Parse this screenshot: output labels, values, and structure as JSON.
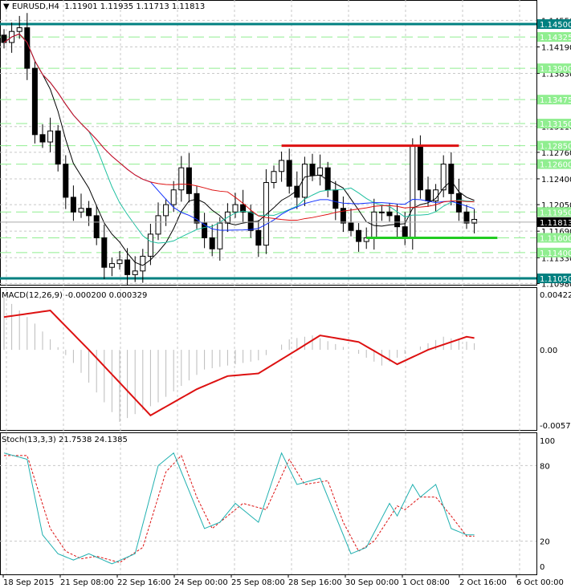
{
  "header": {
    "symbol": "EURUSD,H4",
    "open": "1.11901",
    "high": "1.11935",
    "low": "1.11713",
    "close": "1.11813"
  },
  "price_axis": {
    "min": 1.1098,
    "max": 1.1455,
    "ticks": [
      "1.14550",
      "1.14190",
      "1.13830",
      "1.13110",
      "1.12760",
      "1.12400",
      "1.12050",
      "1.11690",
      "1.11330",
      "1.10980"
    ],
    "current": "1.11813"
  },
  "levels": [
    {
      "price": 1.145,
      "label": "1.14500",
      "color": "#008080",
      "major": true
    },
    {
      "price": 1.14325,
      "label": "1.14325",
      "color": "#90ee90"
    },
    {
      "price": 1.139,
      "label": "1.13900",
      "color": "#90ee90"
    },
    {
      "price": 1.13475,
      "label": "1.13475",
      "color": "#90ee90"
    },
    {
      "price": 1.1315,
      "label": "1.13150",
      "color": "#90ee90"
    },
    {
      "price": 1.1285,
      "label": "1.12850",
      "color": "#90ee90"
    },
    {
      "price": 1.126,
      "label": "1.12600",
      "color": "#90ee90"
    },
    {
      "price": 1.1195,
      "label": "1.11950",
      "color": "#90ee90"
    },
    {
      "price": 1.116,
      "label": "1.11600",
      "color": "#90ee90"
    },
    {
      "price": 1.114,
      "label": "1.11400",
      "color": "#90ee90"
    },
    {
      "price": 1.1105,
      "label": "1.11050",
      "color": "#008080",
      "major": true
    }
  ],
  "resistance": {
    "price": 1.1285,
    "from": 36,
    "to": 59,
    "color": "#dd1111"
  },
  "support": {
    "price": 1.116,
    "from": 47,
    "to": 64,
    "color": "#22cc22"
  },
  "closes": [
    1.1425,
    1.144,
    1.1445,
    1.139,
    1.13,
    1.129,
    1.1305,
    1.126,
    1.1215,
    1.1195,
    1.12,
    1.119,
    1.116,
    1.112,
    1.1125,
    1.113,
    1.111,
    1.1115,
    1.1135,
    1.1165,
    1.119,
    1.1205,
    1.1225,
    1.1255,
    1.122,
    1.118,
    1.116,
    1.1145,
    1.118,
    1.1195,
    1.1205,
    1.1195,
    1.117,
    1.115,
    1.1235,
    1.125,
    1.1265,
    1.123,
    1.1215,
    1.126,
    1.1245,
    1.1255,
    1.1225,
    1.12,
    1.118,
    1.117,
    1.1155,
    1.116,
    1.1195,
    1.1195,
    1.119,
    1.1175,
    1.116,
    1.1285,
    1.1225,
    1.121,
    1.1225,
    1.126,
    1.122,
    1.1195,
    1.118,
    1.1185
  ],
  "macd": {
    "label": "MACD(12,26,9) -0.000200 0.000329",
    "max": 0.004227,
    "min": -0.005744,
    "ticks": [
      "0.004227",
      "0.00",
      "-0.005744"
    ],
    "signal": [
      [
        0,
        0.0025
      ],
      [
        6,
        0.003
      ],
      [
        11,
        0.0
      ],
      [
        19,
        -0.005
      ],
      [
        25,
        -0.003
      ],
      [
        29,
        -0.002
      ],
      [
        33,
        -0.0018
      ],
      [
        38,
        0.0
      ],
      [
        41,
        0.0011
      ],
      [
        46,
        0.0006
      ],
      [
        51,
        -0.0011
      ],
      [
        55,
        0.0
      ],
      [
        60,
        0.001
      ],
      [
        61,
        0.0009
      ]
    ],
    "hist": [
      [
        0,
        0.004
      ],
      [
        4,
        0.002
      ],
      [
        9,
        -0.001
      ],
      [
        15,
        -0.0055
      ],
      [
        20,
        -0.004
      ],
      [
        26,
        -0.0015
      ],
      [
        33,
        -0.0008
      ],
      [
        37,
        0.0008
      ],
      [
        40,
        0.0011
      ],
      [
        45,
        0.0
      ],
      [
        49,
        -0.0012
      ],
      [
        53,
        0.0
      ],
      [
        57,
        0.001
      ],
      [
        61,
        0.0005
      ]
    ]
  },
  "stoch": {
    "label": "Stoch(13,3,3) 21.7538 24.1385",
    "ticks": [
      "100",
      "80",
      "20",
      "0"
    ],
    "main": [
      [
        0,
        90
      ],
      [
        3,
        85
      ],
      [
        5,
        25
      ],
      [
        7,
        10
      ],
      [
        9,
        5
      ],
      [
        11,
        10
      ],
      [
        14,
        2
      ],
      [
        17,
        10
      ],
      [
        20,
        80
      ],
      [
        22,
        90
      ],
      [
        24,
        60
      ],
      [
        26,
        30
      ],
      [
        28,
        35
      ],
      [
        30,
        50
      ],
      [
        33,
        35
      ],
      [
        36,
        90
      ],
      [
        38,
        65
      ],
      [
        41,
        70
      ],
      [
        43,
        40
      ],
      [
        45,
        10
      ],
      [
        47,
        15
      ],
      [
        50,
        50
      ],
      [
        51,
        40
      ],
      [
        53,
        65
      ],
      [
        54,
        55
      ],
      [
        56,
        65
      ],
      [
        58,
        30
      ],
      [
        60,
        25
      ]
    ],
    "signal": [
      [
        0,
        88
      ],
      [
        3,
        88
      ],
      [
        6,
        30
      ],
      [
        8,
        12
      ],
      [
        10,
        6
      ],
      [
        12,
        8
      ],
      [
        15,
        3
      ],
      [
        18,
        15
      ],
      [
        21,
        75
      ],
      [
        23,
        88
      ],
      [
        25,
        55
      ],
      [
        27,
        30
      ],
      [
        29,
        40
      ],
      [
        31,
        50
      ],
      [
        34,
        45
      ],
      [
        37,
        85
      ],
      [
        39,
        65
      ],
      [
        42,
        68
      ],
      [
        44,
        35
      ],
      [
        46,
        12
      ],
      [
        48,
        20
      ],
      [
        51,
        48
      ],
      [
        52,
        45
      ],
      [
        54,
        55
      ],
      [
        56,
        55
      ],
      [
        58,
        40
      ],
      [
        60,
        24
      ]
    ]
  },
  "time_axis": [
    "18 Sep 2015",
    "21 Sep 08:00",
    "22 Sep 16:00",
    "24 Sep 00:00",
    "25 Sep 08:00",
    "28 Sep 16:00",
    "30 Sep 00:00",
    "1 Oct 08:00",
    "2 Oct 16:00",
    "6 Oct 00:00"
  ]
}
